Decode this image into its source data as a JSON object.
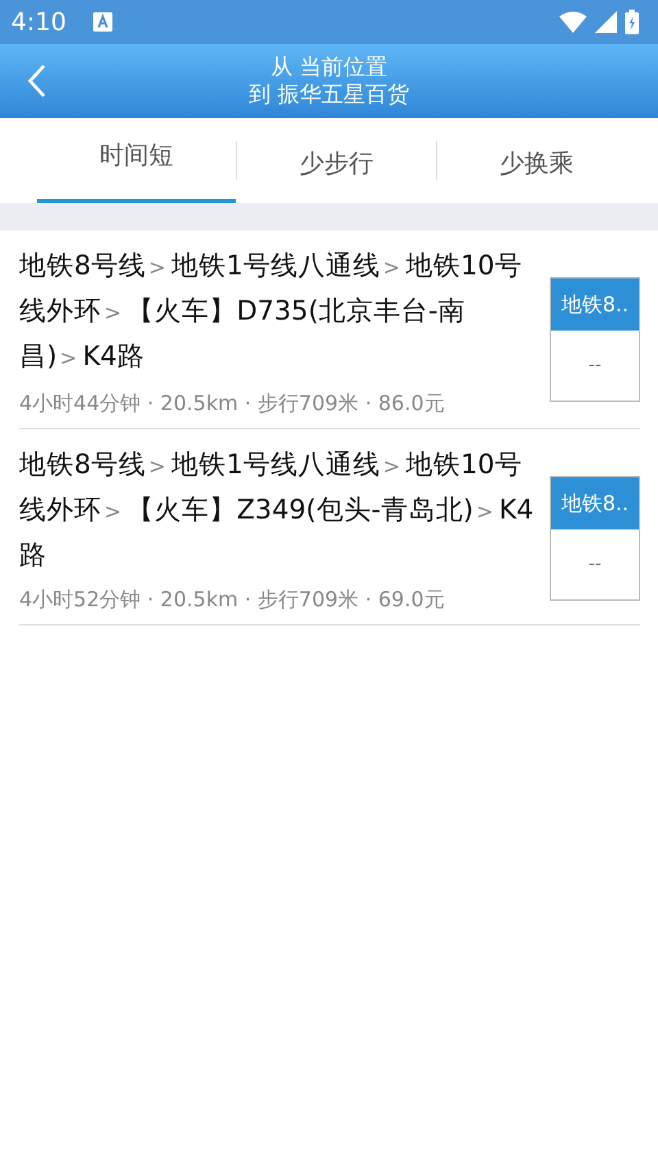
{
  "status_bar": {
    "time": "4:10"
  },
  "header": {
    "line_1": "从 当前位置",
    "line_2": "到 振华五星百货"
  },
  "tabs": [
    {
      "label": "时间短",
      "selected": true
    },
    {
      "label": "少步行",
      "selected": false
    },
    {
      "label": "少换乘",
      "selected": false
    }
  ],
  "routes": [
    {
      "segments": [
        "地铁8号线",
        "地铁1号线八通线",
        "地铁10号线外环",
        "【火车】D735(北京丰台-南昌)",
        "K4路"
      ],
      "separator": ">",
      "summary": "4小时44分钟 · 20.5km · 步行709米 · 86.0元",
      "badge": {
        "line": "地铁8..",
        "value": "--"
      }
    },
    {
      "segments": [
        "地铁8号线",
        "地铁1号线八通线",
        "地铁10号线外环",
        "【火车】Z349(包头-青岛北)",
        "K4路"
      ],
      "separator": ">",
      "summary": "4小时52分钟 · 20.5km · 步行709米 · 69.0元",
      "badge": {
        "line": "地铁8..",
        "value": "--"
      }
    }
  ]
}
